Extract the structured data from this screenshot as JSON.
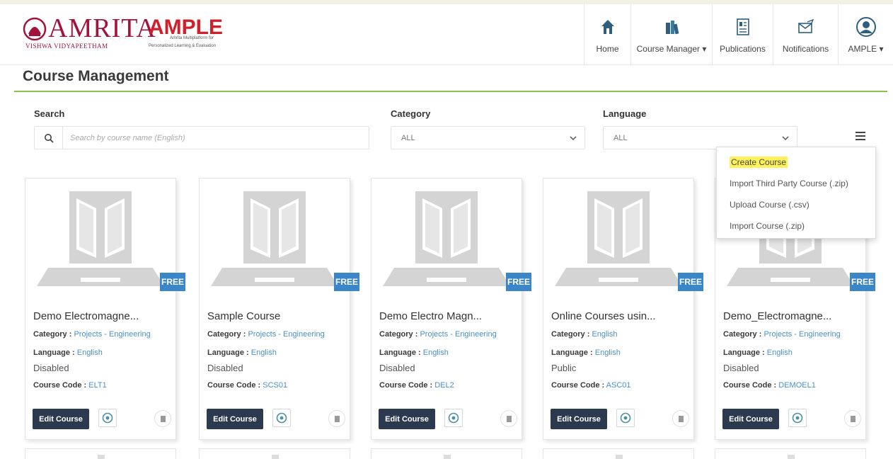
{
  "header": {
    "logo": {
      "amrita": "AMRITA",
      "sub": "VISHWA VIDYAPEETHAM",
      "ample": "AMPLE",
      "tagline_1": "Amrita Multiplatform for",
      "tagline_2": "Personalized Learning & Evaluation"
    },
    "nav": [
      {
        "label": "Home",
        "icon": "home-icon"
      },
      {
        "label": "Course Manager ▾",
        "icon": "books-icon"
      },
      {
        "label": "Publications",
        "icon": "publication-icon"
      },
      {
        "label": "Notifications",
        "icon": "notification-icon"
      },
      {
        "label": "AMPLE ▾",
        "icon": "user-avatar-icon"
      }
    ]
  },
  "page": {
    "title": "Course Management"
  },
  "filters": {
    "search_label": "Search",
    "search_placeholder": "Search by course name (English)",
    "category_label": "Category",
    "category_value": "ALL",
    "language_label": "Language",
    "language_value": "ALL"
  },
  "menu": {
    "items": [
      "Create Course",
      "Import Third Party Course (.zip)",
      "Upload Course (.csv)",
      "Import Course (.zip)"
    ]
  },
  "cards": [
    {
      "title": "Demo Electromagne...",
      "category_key": "Category :",
      "category": "Projects - Engineering",
      "language_key": "Language :",
      "language": "English",
      "status": "Disabled",
      "code_key": "Course Code :",
      "code": "ELT1",
      "badge": "FREE",
      "edit_label": "Edit Course"
    },
    {
      "title": "Sample Course",
      "category_key": "Category :",
      "category": "Projects - Engineering",
      "language_key": "Language :",
      "language": "English",
      "status": "Disabled",
      "code_key": "Course Code :",
      "code": "SCS01",
      "badge": "FREE",
      "edit_label": "Edit Course"
    },
    {
      "title": "Demo Electro Magn...",
      "category_key": "Category :",
      "category": "Projects - Engineering",
      "language_key": "Language :",
      "language": "English",
      "status": "Disabled",
      "code_key": "Course Code :",
      "code": "DEL2",
      "badge": "FREE",
      "edit_label": "Edit Course"
    },
    {
      "title": "Online Courses usin...",
      "category_key": "Category :",
      "category": "English",
      "language_key": "Language :",
      "language": "English",
      "status": "Public",
      "code_key": "Course Code :",
      "code": "ASC01",
      "badge": "FREE",
      "edit_label": "Edit Course"
    },
    {
      "title": "Demo_Electromagne...",
      "category_key": "Category :",
      "category": "Projects - Engineering",
      "language_key": "Language :",
      "language": "English",
      "status": "Disabled",
      "code_key": "Course Code :",
      "code": "DEMOEL1",
      "badge": "FREE",
      "edit_label": "Edit Course"
    }
  ],
  "colors": {
    "accent_green": "#8bc34a",
    "brand_red": "#a3123a",
    "badge_blue": "#3a86c8",
    "button_dark": "#2c3a4f",
    "highlight": "#fcf25b"
  }
}
